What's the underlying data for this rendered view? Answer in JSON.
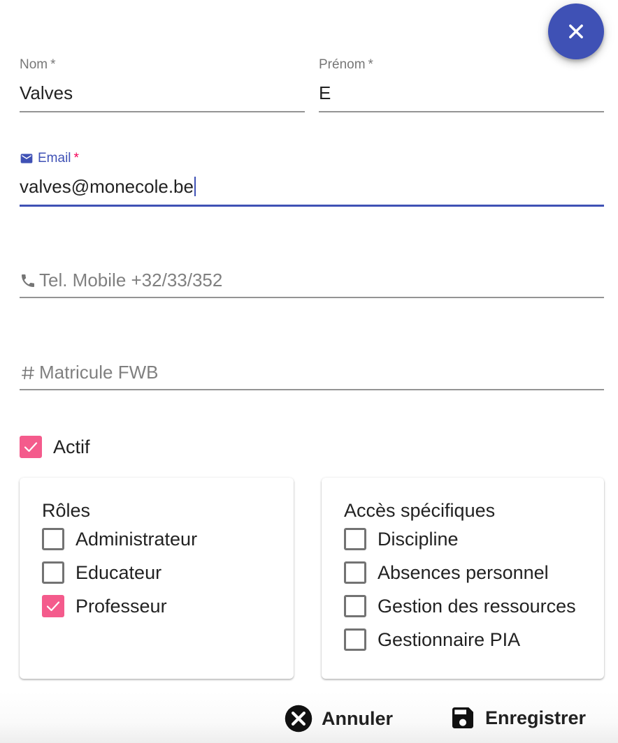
{
  "close_button": {
    "icon": "close-icon",
    "color": "#3f51b5"
  },
  "fields": {
    "nom": {
      "label": "Nom",
      "required_mark": "*",
      "value": "Valves"
    },
    "prenom": {
      "label": "Prénom",
      "required_mark": "*",
      "value": "E"
    },
    "email": {
      "label": "Email",
      "required_mark": "*",
      "value": "valves@monecole.be",
      "icon": "mail-icon"
    },
    "mobile": {
      "placeholder": "Tel. Mobile +32/33/352",
      "icon": "phone-icon"
    },
    "matricule": {
      "placeholder": "Matricule FWB",
      "icon": "hash-icon"
    }
  },
  "actif": {
    "label": "Actif",
    "checked": true
  },
  "roles": {
    "title": "Rôles",
    "items": [
      {
        "label": "Administrateur",
        "checked": false
      },
      {
        "label": "Educateur",
        "checked": false
      },
      {
        "label": "Professeur",
        "checked": true
      }
    ]
  },
  "acces": {
    "title": "Accès spécifiques",
    "items": [
      {
        "label": "Discipline",
        "checked": false
      },
      {
        "label": "Absences personnel",
        "checked": false
      },
      {
        "label": "Gestion des ressources",
        "checked": false
      },
      {
        "label": "Gestionnaire PIA",
        "checked": false
      }
    ]
  },
  "actions": {
    "cancel_label": "Annuler",
    "cancel_icon": "cancel-circle-icon",
    "save_label": "Enregistrer",
    "save_icon": "save-icon"
  },
  "colors": {
    "primary": "#3f51b5",
    "accent": "#f50057",
    "checkbox_checked": "#f45b8c"
  }
}
